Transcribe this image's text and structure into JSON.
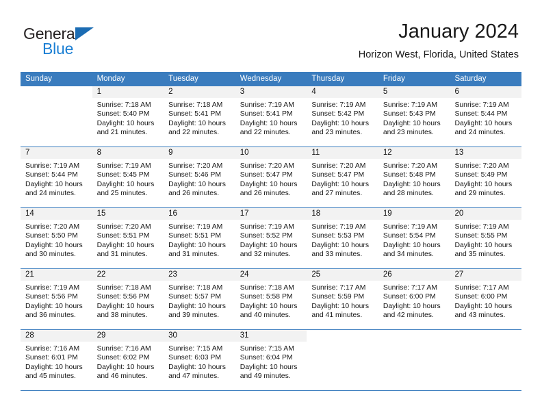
{
  "brand": {
    "name_dark": "General",
    "name_blue": "Blue",
    "accent_blue": "#1b7fd4",
    "flag_blue": "#1b6cb3"
  },
  "header": {
    "title": "January 2024",
    "subtitle": "Horizon West, Florida, United States"
  },
  "theme": {
    "header_bg": "#3a7cbe",
    "day_band_bg": "#f2f2f2",
    "text": "#161616"
  },
  "weekdays": [
    "Sunday",
    "Monday",
    "Tuesday",
    "Wednesday",
    "Thursday",
    "Friday",
    "Saturday"
  ],
  "weeks": [
    [
      {
        "day": "",
        "lines": []
      },
      {
        "day": "1",
        "lines": [
          "Sunrise: 7:18 AM",
          "Sunset: 5:40 PM",
          "Daylight: 10 hours",
          "and 21 minutes."
        ]
      },
      {
        "day": "2",
        "lines": [
          "Sunrise: 7:18 AM",
          "Sunset: 5:41 PM",
          "Daylight: 10 hours",
          "and 22 minutes."
        ]
      },
      {
        "day": "3",
        "lines": [
          "Sunrise: 7:19 AM",
          "Sunset: 5:41 PM",
          "Daylight: 10 hours",
          "and 22 minutes."
        ]
      },
      {
        "day": "4",
        "lines": [
          "Sunrise: 7:19 AM",
          "Sunset: 5:42 PM",
          "Daylight: 10 hours",
          "and 23 minutes."
        ]
      },
      {
        "day": "5",
        "lines": [
          "Sunrise: 7:19 AM",
          "Sunset: 5:43 PM",
          "Daylight: 10 hours",
          "and 23 minutes."
        ]
      },
      {
        "day": "6",
        "lines": [
          "Sunrise: 7:19 AM",
          "Sunset: 5:44 PM",
          "Daylight: 10 hours",
          "and 24 minutes."
        ]
      }
    ],
    [
      {
        "day": "7",
        "lines": [
          "Sunrise: 7:19 AM",
          "Sunset: 5:44 PM",
          "Daylight: 10 hours",
          "and 24 minutes."
        ]
      },
      {
        "day": "8",
        "lines": [
          "Sunrise: 7:19 AM",
          "Sunset: 5:45 PM",
          "Daylight: 10 hours",
          "and 25 minutes."
        ]
      },
      {
        "day": "9",
        "lines": [
          "Sunrise: 7:20 AM",
          "Sunset: 5:46 PM",
          "Daylight: 10 hours",
          "and 26 minutes."
        ]
      },
      {
        "day": "10",
        "lines": [
          "Sunrise: 7:20 AM",
          "Sunset: 5:47 PM",
          "Daylight: 10 hours",
          "and 26 minutes."
        ]
      },
      {
        "day": "11",
        "lines": [
          "Sunrise: 7:20 AM",
          "Sunset: 5:47 PM",
          "Daylight: 10 hours",
          "and 27 minutes."
        ]
      },
      {
        "day": "12",
        "lines": [
          "Sunrise: 7:20 AM",
          "Sunset: 5:48 PM",
          "Daylight: 10 hours",
          "and 28 minutes."
        ]
      },
      {
        "day": "13",
        "lines": [
          "Sunrise: 7:20 AM",
          "Sunset: 5:49 PM",
          "Daylight: 10 hours",
          "and 29 minutes."
        ]
      }
    ],
    [
      {
        "day": "14",
        "lines": [
          "Sunrise: 7:20 AM",
          "Sunset: 5:50 PM",
          "Daylight: 10 hours",
          "and 30 minutes."
        ]
      },
      {
        "day": "15",
        "lines": [
          "Sunrise: 7:20 AM",
          "Sunset: 5:51 PM",
          "Daylight: 10 hours",
          "and 31 minutes."
        ]
      },
      {
        "day": "16",
        "lines": [
          "Sunrise: 7:19 AM",
          "Sunset: 5:51 PM",
          "Daylight: 10 hours",
          "and 31 minutes."
        ]
      },
      {
        "day": "17",
        "lines": [
          "Sunrise: 7:19 AM",
          "Sunset: 5:52 PM",
          "Daylight: 10 hours",
          "and 32 minutes."
        ]
      },
      {
        "day": "18",
        "lines": [
          "Sunrise: 7:19 AM",
          "Sunset: 5:53 PM",
          "Daylight: 10 hours",
          "and 33 minutes."
        ]
      },
      {
        "day": "19",
        "lines": [
          "Sunrise: 7:19 AM",
          "Sunset: 5:54 PM",
          "Daylight: 10 hours",
          "and 34 minutes."
        ]
      },
      {
        "day": "20",
        "lines": [
          "Sunrise: 7:19 AM",
          "Sunset: 5:55 PM",
          "Daylight: 10 hours",
          "and 35 minutes."
        ]
      }
    ],
    [
      {
        "day": "21",
        "lines": [
          "Sunrise: 7:19 AM",
          "Sunset: 5:56 PM",
          "Daylight: 10 hours",
          "and 36 minutes."
        ]
      },
      {
        "day": "22",
        "lines": [
          "Sunrise: 7:18 AM",
          "Sunset: 5:56 PM",
          "Daylight: 10 hours",
          "and 38 minutes."
        ]
      },
      {
        "day": "23",
        "lines": [
          "Sunrise: 7:18 AM",
          "Sunset: 5:57 PM",
          "Daylight: 10 hours",
          "and 39 minutes."
        ]
      },
      {
        "day": "24",
        "lines": [
          "Sunrise: 7:18 AM",
          "Sunset: 5:58 PM",
          "Daylight: 10 hours",
          "and 40 minutes."
        ]
      },
      {
        "day": "25",
        "lines": [
          "Sunrise: 7:17 AM",
          "Sunset: 5:59 PM",
          "Daylight: 10 hours",
          "and 41 minutes."
        ]
      },
      {
        "day": "26",
        "lines": [
          "Sunrise: 7:17 AM",
          "Sunset: 6:00 PM",
          "Daylight: 10 hours",
          "and 42 minutes."
        ]
      },
      {
        "day": "27",
        "lines": [
          "Sunrise: 7:17 AM",
          "Sunset: 6:00 PM",
          "Daylight: 10 hours",
          "and 43 minutes."
        ]
      }
    ],
    [
      {
        "day": "28",
        "lines": [
          "Sunrise: 7:16 AM",
          "Sunset: 6:01 PM",
          "Daylight: 10 hours",
          "and 45 minutes."
        ]
      },
      {
        "day": "29",
        "lines": [
          "Sunrise: 7:16 AM",
          "Sunset: 6:02 PM",
          "Daylight: 10 hours",
          "and 46 minutes."
        ]
      },
      {
        "day": "30",
        "lines": [
          "Sunrise: 7:15 AM",
          "Sunset: 6:03 PM",
          "Daylight: 10 hours",
          "and 47 minutes."
        ]
      },
      {
        "day": "31",
        "lines": [
          "Sunrise: 7:15 AM",
          "Sunset: 6:04 PM",
          "Daylight: 10 hours",
          "and 49 minutes."
        ]
      },
      {
        "day": "",
        "lines": []
      },
      {
        "day": "",
        "lines": []
      },
      {
        "day": "",
        "lines": []
      }
    ]
  ]
}
